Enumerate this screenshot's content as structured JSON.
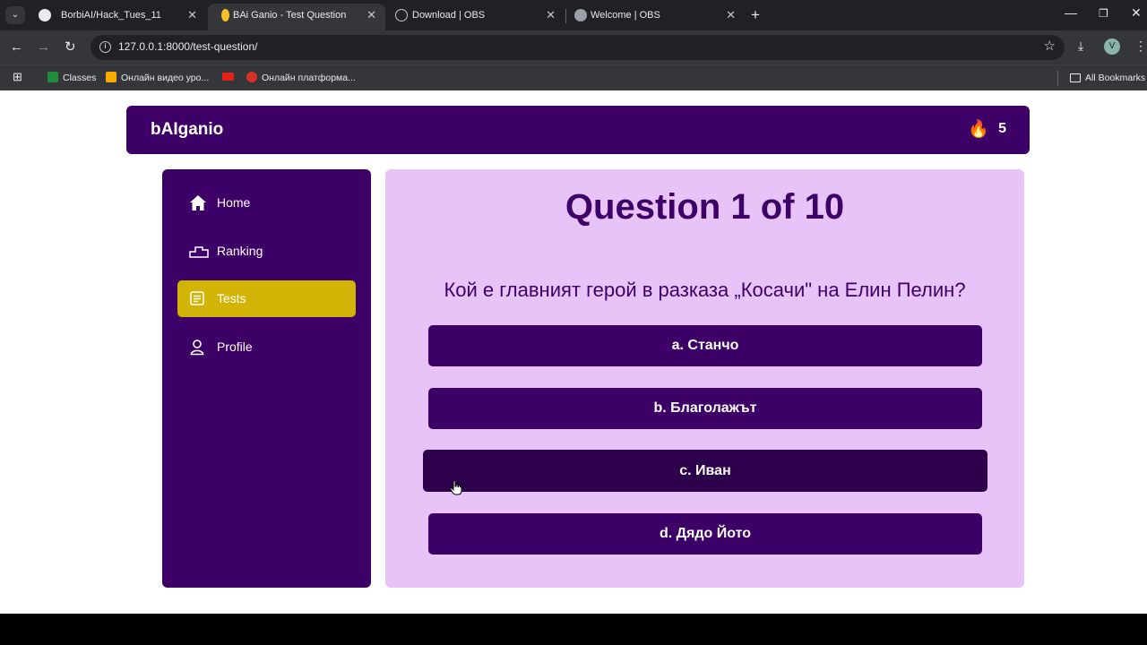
{
  "browser": {
    "tabs": [
      {
        "title": "BorbiAI/Hack_Tues_11",
        "icon": "github-icon",
        "active": false
      },
      {
        "title": "BAi Ganio - Test Question",
        "icon": "lightbulb-icon",
        "active": true
      },
      {
        "title": "Download | OBS",
        "icon": "obs-icon",
        "active": false
      },
      {
        "title": "Welcome | OBS",
        "icon": "globe-icon",
        "active": false
      }
    ],
    "url": "127.0.0.1:8000/test-question/",
    "profile_initial": "V",
    "bookmarks": [
      {
        "label": "Classes",
        "icon": "classroom-icon",
        "color": "#1e8e3e"
      },
      {
        "label": "Онлайн видео уро...",
        "icon": "y-icon",
        "color": "#f9ab00"
      },
      {
        "label": "",
        "icon": "youtube-icon",
        "color": "#e62117"
      },
      {
        "label": "Онлайн платформа...",
        "icon": "a-icon",
        "color": "#d93025"
      }
    ],
    "all_bookmarks_label": "All Bookmarks"
  },
  "app": {
    "brand": "bAIganio",
    "streak": "5",
    "colors": {
      "primary": "#3d0066",
      "active": "#d2b406",
      "panel": "#e8c3f8"
    }
  },
  "sidebar": {
    "items": [
      {
        "label": "Home",
        "icon": "home-icon"
      },
      {
        "label": "Ranking",
        "icon": "podium-icon"
      },
      {
        "label": "Tests",
        "icon": "tests-icon",
        "active": true
      },
      {
        "label": "Profile",
        "icon": "profile-icon"
      }
    ]
  },
  "question": {
    "title": "Question 1 of 10",
    "text": "Кой е главният герой в разказа „Косачи\" на Елин Пелин?",
    "answers": [
      {
        "label": "a. Станчо"
      },
      {
        "label": "b. Благолажът"
      },
      {
        "label": "c. Иван",
        "hovered": true
      },
      {
        "label": "d. Дядо Йото"
      }
    ]
  }
}
